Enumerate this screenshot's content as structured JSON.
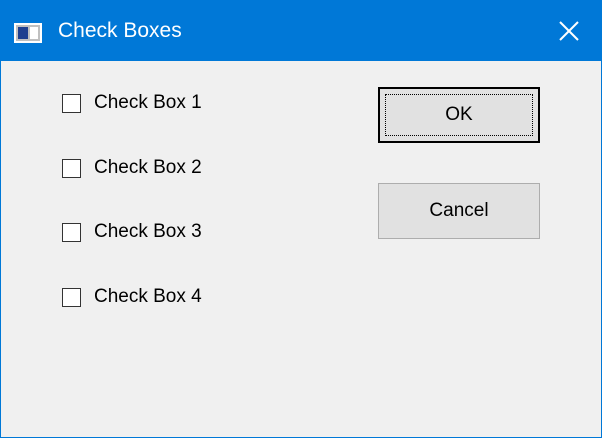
{
  "window": {
    "title": "Check Boxes",
    "titlebar_color": "#0078d7",
    "icons": {
      "app": "application-window-icon",
      "close": "close-icon"
    }
  },
  "checkboxes": [
    {
      "label": "Check Box 1",
      "checked": false
    },
    {
      "label": "Check Box 2",
      "checked": false
    },
    {
      "label": "Check Box 3",
      "checked": false
    },
    {
      "label": "Check Box 4",
      "checked": false
    }
  ],
  "buttons": {
    "ok_label": "OK",
    "cancel_label": "Cancel",
    "default": "ok"
  }
}
